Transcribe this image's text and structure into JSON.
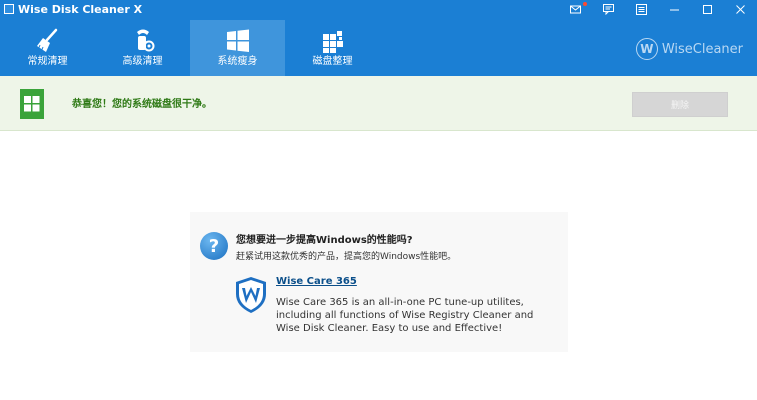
{
  "window": {
    "title": "Wise Disk Cleaner X",
    "controls": [
      "mail-icon",
      "feedback-icon",
      "menu-icon",
      "minimize-icon",
      "maximize-icon",
      "close-icon"
    ]
  },
  "tabs": [
    {
      "label": "常规清理",
      "icon": "broom-icon",
      "active": false
    },
    {
      "label": "高级清理",
      "icon": "vacuum-icon",
      "active": false
    },
    {
      "label": "系统瘦身",
      "icon": "windows-icon",
      "active": true
    },
    {
      "label": "磁盘整理",
      "icon": "defrag-icon",
      "active": false
    }
  ],
  "brand": {
    "logo": "W",
    "text": "WiseCleaner"
  },
  "status": {
    "message": "恭喜您！您的系统磁盘很干净。",
    "delete_label": "删除",
    "icon": "windows-icon"
  },
  "promo": {
    "question_icon": "?",
    "title": "您想要进一步提高Windows的性能吗?",
    "subtitle": "赶紧试用这款优秀的产品，提高您的Windows性能吧。",
    "product_name": "Wise Care 365",
    "description": "Wise Care 365 is an all-in-one PC tune-up utilites, including all functions of Wise Registry Cleaner and Wise Disk Cleaner. Easy to use and Effective!"
  },
  "colors": {
    "header": "#1b7fd4",
    "active_tab": "#3f95dc",
    "status_bg": "#eef5e8",
    "status_text": "#2f7a16",
    "link": "#0b4f8a"
  }
}
